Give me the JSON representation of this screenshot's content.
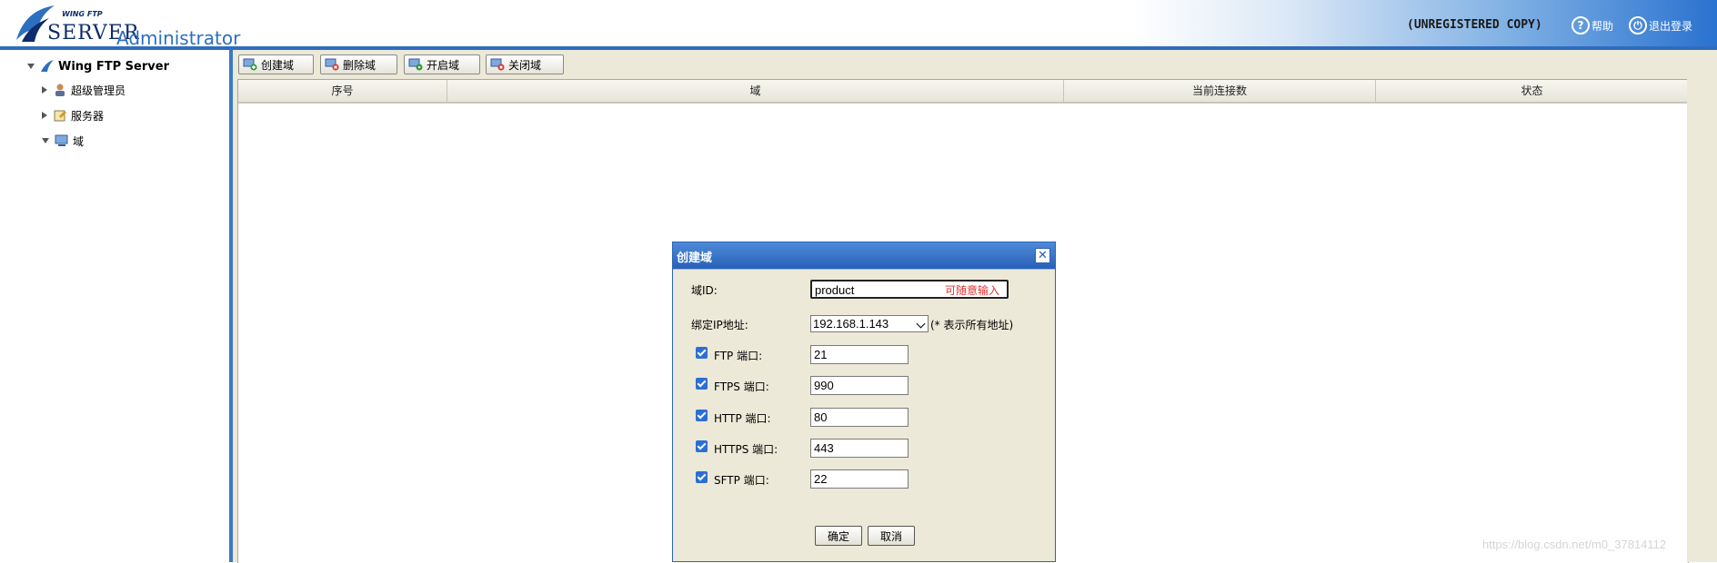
{
  "header": {
    "logo_small": "WING FTP",
    "logo_server": "SERVER",
    "logo_admin": "Administrator",
    "unregistered": "(UNREGISTERED COPY)",
    "help_label": "帮助",
    "logout_label": "退出登录"
  },
  "tree": {
    "root": "Wing FTP Server",
    "items": [
      "超级管理员",
      "服务器",
      "域"
    ]
  },
  "toolbar": {
    "create": "创建域",
    "delete": "删除域",
    "start": "开启域",
    "stop": "关闭域"
  },
  "table": {
    "columns": [
      "序号",
      "域",
      "当前连接数",
      "状态"
    ]
  },
  "dialog": {
    "title": "创建域",
    "domain_id_label": "域ID:",
    "domain_id_value": "product",
    "domain_id_hint": "可随意输入",
    "ip_label": "绑定IP地址:",
    "ip_value": "192.168.1.143",
    "ip_note": "(* 表示所有地址)",
    "ports": [
      {
        "label": "FTP 端口:",
        "value": "21"
      },
      {
        "label": "FTPS 端口:",
        "value": "990"
      },
      {
        "label": "HTTP 端口:",
        "value": "80"
      },
      {
        "label": "HTTPS 端口:",
        "value": "443"
      },
      {
        "label": "SFTP 端口:",
        "value": "22"
      }
    ],
    "ok": "确定",
    "cancel": "取消"
  },
  "watermark": "https://blog.csdn.net/m0_37814112",
  "colors": {
    "accent": "#2f6cbf",
    "dialog_title": "#2861b8",
    "hint_red": "#e53030",
    "checkbox": "#2b6fd6"
  }
}
